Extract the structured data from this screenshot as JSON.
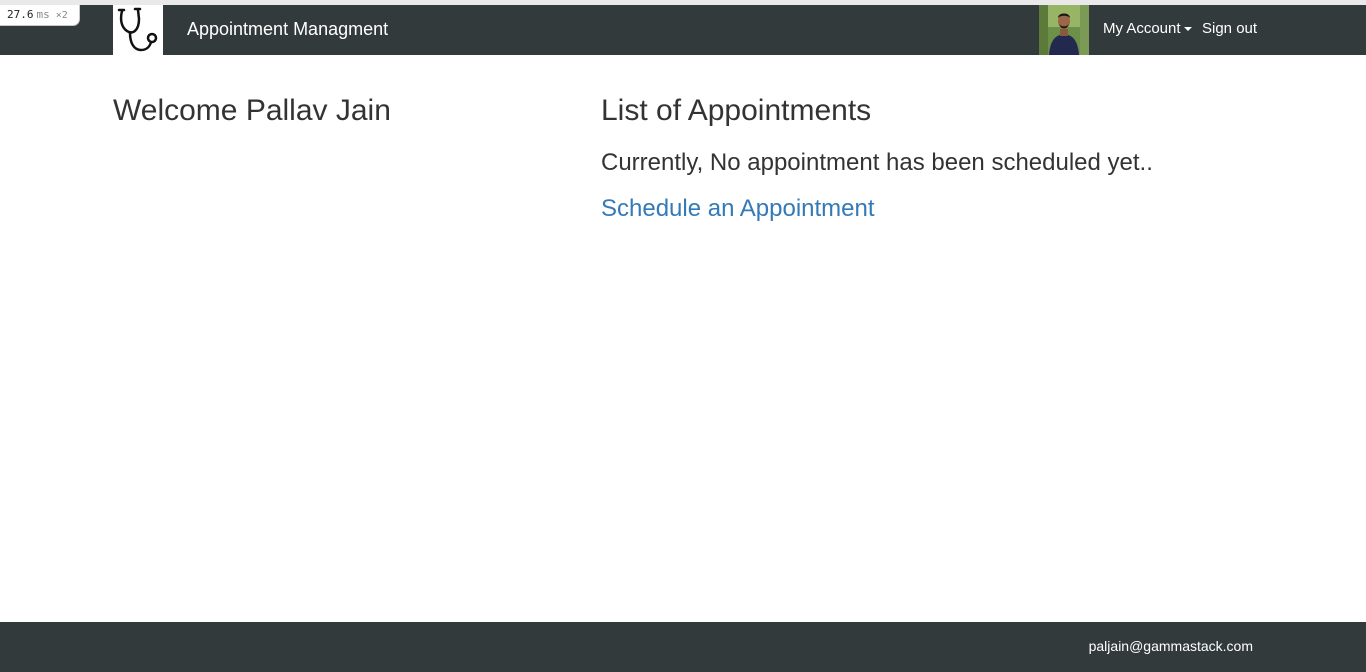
{
  "timing": {
    "value": "27.6",
    "unit": "ms",
    "multiplier": "×2"
  },
  "navbar": {
    "logo_icon": "stethoscope-icon",
    "brand": "Appointment Managment",
    "my_account": "My Account",
    "sign_out": "Sign out",
    "background": "#333a3b"
  },
  "main": {
    "welcome": "Welcome Pallav Jain",
    "list_title": "List of Appointments",
    "empty_message": "Currently, No appointment has been scheduled yet..",
    "schedule_link": "Schedule an Appointment",
    "link_color": "#337ab7"
  },
  "footer": {
    "email": "paljain@gammastack.com"
  }
}
